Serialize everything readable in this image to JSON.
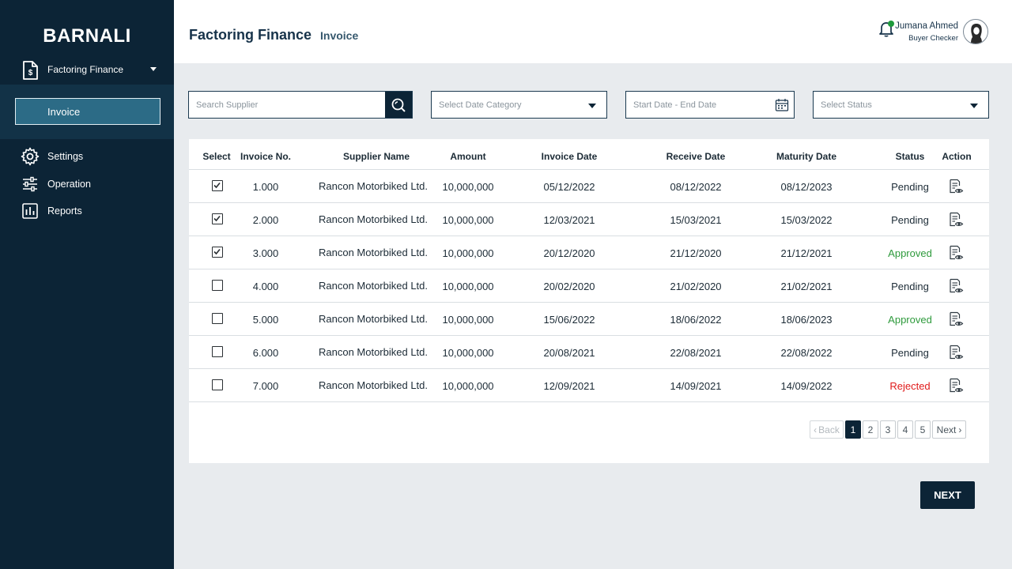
{
  "sidebar": {
    "brand": "BARNALI",
    "parent": {
      "label": "Factoring Finance",
      "icon": "document-money-icon"
    },
    "subitem": {
      "label": "Invoice"
    },
    "items": [
      {
        "label": "Settings",
        "icon": "gear-icon"
      },
      {
        "label": "Operation",
        "icon": "sliders-icon"
      },
      {
        "label": "Reports",
        "icon": "bar-chart-icon"
      }
    ]
  },
  "header": {
    "title": "Factoring Finance",
    "subtitle": "Invoice",
    "user": {
      "name": "Jumana Ahmed",
      "role": "Buyer Checker"
    }
  },
  "filters": {
    "search_placeholder": "Search Supplier",
    "date_category": "Select Date Category",
    "date_range": "Start Date - End Date",
    "status": "Select Status"
  },
  "table": {
    "columns": [
      "Select",
      "Invoice No.",
      "Supplier Name",
      "Amount",
      "Invoice Date",
      "Receive Date",
      "Maturity Date",
      "Status",
      "Action"
    ],
    "rows": [
      {
        "checked": true,
        "invoice_no": "1.000",
        "supplier": "Rancon Motorbiked Ltd.",
        "amount": "10,000,000",
        "invoice_date": "05/12/2022",
        "receive_date": "08/12/2022",
        "maturity_date": "08/12/2023",
        "status": "Pending"
      },
      {
        "checked": true,
        "invoice_no": "2.000",
        "supplier": "Rancon Motorbiked Ltd.",
        "amount": "10,000,000",
        "invoice_date": "12/03/2021",
        "receive_date": "15/03/2021",
        "maturity_date": "15/03/2022",
        "status": "Pending"
      },
      {
        "checked": true,
        "invoice_no": "3.000",
        "supplier": "Rancon Motorbiked Ltd.",
        "amount": "10,000,000",
        "invoice_date": "20/12/2020",
        "receive_date": "21/12/2020",
        "maturity_date": "21/12/2021",
        "status": "Approved"
      },
      {
        "checked": false,
        "invoice_no": "4.000",
        "supplier": "Rancon Motorbiked Ltd.",
        "amount": "10,000,000",
        "invoice_date": "20/02/2020",
        "receive_date": "21/02/2020",
        "maturity_date": "21/02/2021",
        "status": "Pending"
      },
      {
        "checked": false,
        "invoice_no": "5.000",
        "supplier": "Rancon Motorbiked Ltd.",
        "amount": "10,000,000",
        "invoice_date": "15/06/2022",
        "receive_date": "18/06/2022",
        "maturity_date": "18/06/2023",
        "status": "Approved"
      },
      {
        "checked": false,
        "invoice_no": "6.000",
        "supplier": "Rancon Motorbiked Ltd.",
        "amount": "10,000,000",
        "invoice_date": "20/08/2021",
        "receive_date": "22/08/2021",
        "maturity_date": "22/08/2022",
        "status": "Pending"
      },
      {
        "checked": false,
        "invoice_no": "7.000",
        "supplier": "Rancon Motorbiked Ltd.",
        "amount": "10,000,000",
        "invoice_date": "12/09/2021",
        "receive_date": "14/09/2021",
        "maturity_date": "14/09/2022",
        "status": "Rejected"
      }
    ]
  },
  "pagination": {
    "back": "Back",
    "pages": [
      "1",
      "2",
      "3",
      "4",
      "5"
    ],
    "current": "1",
    "next": "Next"
  },
  "next_button": "NEXT",
  "colors": {
    "sidebar": "#0c2436",
    "accent": "#2c6b86",
    "approved": "#2e9a3c",
    "rejected": "#e01b1b",
    "online": "#1e9a3c"
  }
}
